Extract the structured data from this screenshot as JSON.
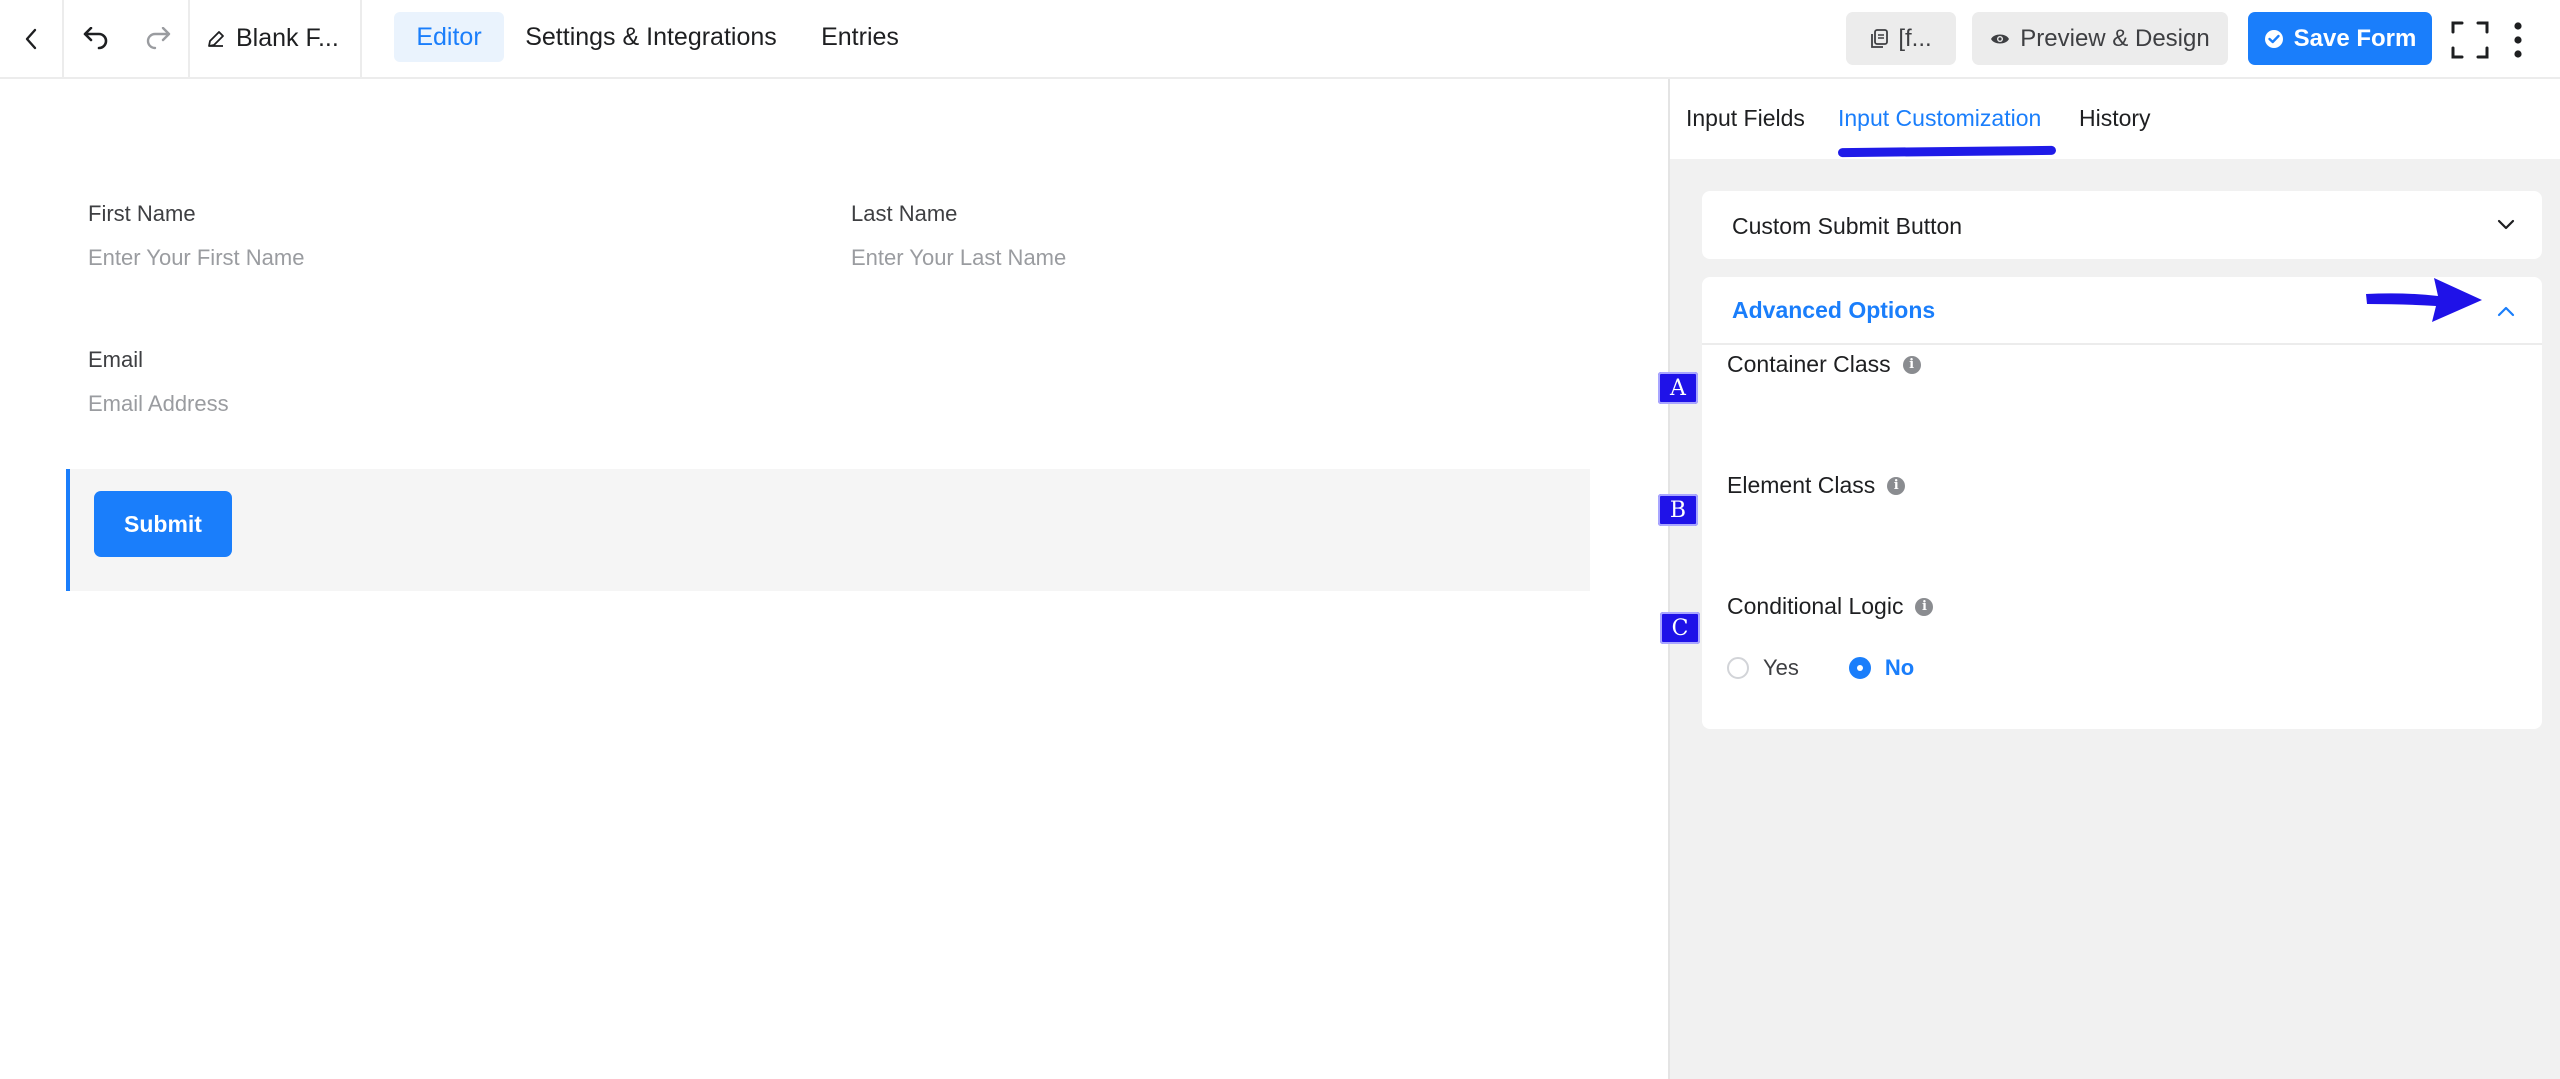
{
  "topbar": {
    "form_title": "Blank F...",
    "nav": {
      "editor": "Editor",
      "settings": "Settings & Integrations",
      "entries": "Entries"
    },
    "shortcode_label": "[f...",
    "preview_label": "Preview & Design",
    "save_label": "Save Form"
  },
  "form": {
    "first_name": {
      "label": "First Name",
      "placeholder": "Enter Your First Name"
    },
    "last_name": {
      "label": "Last Name",
      "placeholder": "Enter Your Last Name"
    },
    "email": {
      "label": "Email",
      "placeholder": "Email Address"
    },
    "submit_label": "Submit"
  },
  "panel": {
    "tabs": {
      "input_fields": "Input Fields",
      "input_customization": "Input Customization",
      "history": "History"
    },
    "custom_submit_button": "Custom Submit Button",
    "advanced_options": {
      "title": "Advanced Options",
      "container_class": "Container Class",
      "element_class": "Element Class",
      "conditional_logic": "Conditional Logic",
      "radio_yes": "Yes",
      "radio_no": "No",
      "selected": "No"
    }
  },
  "annotations": {
    "markers": [
      "A",
      "B",
      "C"
    ]
  },
  "colors": {
    "accent": "#1a7efb",
    "annotation": "#1f12e8"
  }
}
